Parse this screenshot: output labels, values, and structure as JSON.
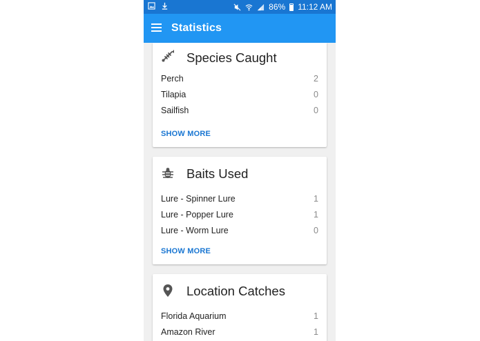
{
  "status_bar": {
    "battery": "86%",
    "time": "11:12 AM"
  },
  "app_bar": {
    "title": "Statistics"
  },
  "cards": [
    {
      "title": "Species Caught",
      "icon": "fish-bone-icon",
      "rows": [
        {
          "label": "Perch",
          "count": "2"
        },
        {
          "label": "Tilapia",
          "count": "0"
        },
        {
          "label": "Sailfish",
          "count": "0"
        }
      ],
      "show_more": "SHOW MORE"
    },
    {
      "title": "Baits Used",
      "icon": "bug-icon",
      "rows": [
        {
          "label": "Lure - Spinner Lure",
          "count": "1"
        },
        {
          "label": "Lure - Popper Lure",
          "count": "1"
        },
        {
          "label": "Lure - Worm Lure",
          "count": "0"
        }
      ],
      "show_more": "SHOW MORE"
    },
    {
      "title": "Location Catches",
      "icon": "map-pin-icon",
      "rows": [
        {
          "label": "Florida Aquarium",
          "count": "1"
        },
        {
          "label": "Amazon River",
          "count": "1"
        }
      ]
    }
  ],
  "colors": {
    "status_bar": "#1976d2",
    "app_bar": "#2196f3",
    "accent": "#1976d2",
    "background": "#f0f0f0"
  }
}
